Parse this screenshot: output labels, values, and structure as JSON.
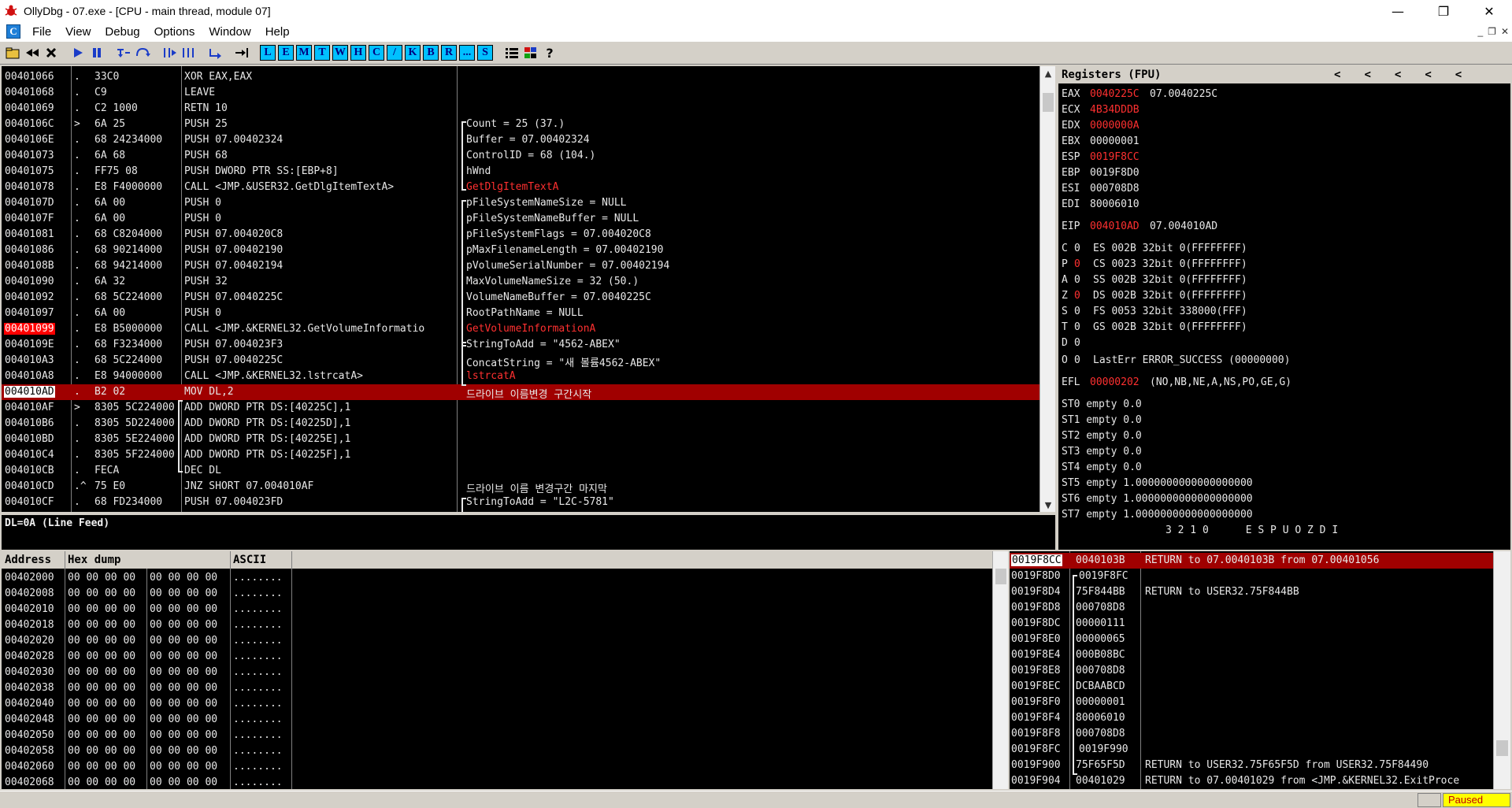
{
  "window": {
    "title": "OllyDbg - 07.exe - [CPU - main thread, module 07]",
    "minimize": "—",
    "maximize": "❐",
    "close": "✕"
  },
  "menu": {
    "items": [
      "File",
      "View",
      "Debug",
      "Options",
      "Window",
      "Help"
    ],
    "logo": "C"
  },
  "toolbar": {
    "letters": [
      "L",
      "E",
      "M",
      "T",
      "W",
      "H",
      "C",
      "/",
      "K",
      "B",
      "R",
      "...",
      "S"
    ]
  },
  "cpu": {
    "rows": [
      {
        "addr": "00401066",
        "mark": ".",
        "hex": "33C0",
        "asm": "XOR EAX,EAX",
        "cmt": ""
      },
      {
        "addr": "00401068",
        "mark": ".",
        "hex": "C9",
        "asm": "LEAVE",
        "cmt": ""
      },
      {
        "addr": "00401069",
        "mark": ".",
        "hex": "C2 1000",
        "asm": "RETN 10",
        "cmt": ""
      },
      {
        "addr": "0040106C",
        "mark": ">",
        "hex": "6A 25",
        "asm": "PUSH 25",
        "cmt": "Count = 25 (37.)"
      },
      {
        "addr": "0040106E",
        "mark": ".",
        "hex": "68 24234000",
        "asm": "PUSH 07.00402324",
        "cmt": "Buffer = 07.00402324"
      },
      {
        "addr": "00401073",
        "mark": ".",
        "hex": "6A 68",
        "asm": "PUSH 68",
        "cmt": "ControlID = 68 (104.)"
      },
      {
        "addr": "00401075",
        "mark": ".",
        "hex": "FF75 08",
        "asm": "PUSH DWORD PTR SS:[EBP+8]",
        "cmt": "hWnd"
      },
      {
        "addr": "00401078",
        "mark": ".",
        "hex": "E8 F4000000",
        "asm": "CALL <JMP.&USER32.GetDlgItemTextA>",
        "cmt": "GetDlgItemTextA"
      },
      {
        "addr": "0040107D",
        "mark": ".",
        "hex": "6A 00",
        "asm": "PUSH 0",
        "cmt": "pFileSystemNameSize = NULL"
      },
      {
        "addr": "0040107F",
        "mark": ".",
        "hex": "6A 00",
        "asm": "PUSH 0",
        "cmt": "pFileSystemNameBuffer = NULL"
      },
      {
        "addr": "00401081",
        "mark": ".",
        "hex": "68 C8204000",
        "asm": "PUSH 07.004020C8",
        "cmt": "pFileSystemFlags = 07.004020C8"
      },
      {
        "addr": "00401086",
        "mark": ".",
        "hex": "68 90214000",
        "asm": "PUSH 07.00402190",
        "cmt": "pMaxFilenameLength = 07.00402190"
      },
      {
        "addr": "0040108B",
        "mark": ".",
        "hex": "68 94214000",
        "asm": "PUSH 07.00402194",
        "cmt": "pVolumeSerialNumber = 07.00402194"
      },
      {
        "addr": "00401090",
        "mark": ".",
        "hex": "6A 32",
        "asm": "PUSH 32",
        "cmt": "MaxVolumeNameSize = 32 (50.)"
      },
      {
        "addr": "00401092",
        "mark": ".",
        "hex": "68 5C224000",
        "asm": "PUSH 07.0040225C",
        "cmt": "VolumeNameBuffer = 07.0040225C"
      },
      {
        "addr": "00401097",
        "mark": ".",
        "hex": "6A 00",
        "asm": "PUSH 0",
        "cmt": "RootPathName = NULL"
      },
      {
        "addr": "00401099",
        "mark": ".",
        "hex": "E8 B5000000",
        "asm": "CALL <JMP.&KERNEL32.GetVolumeInformatio",
        "cmt": "GetVolumeInformationA"
      },
      {
        "addr": "0040109E",
        "mark": ".",
        "hex": "68 F3234000",
        "asm": "PUSH 07.004023F3",
        "cmt": "StringToAdd = \"4562-ABEX\""
      },
      {
        "addr": "004010A3",
        "mark": ".",
        "hex": "68 5C224000",
        "asm": "PUSH 07.0040225C",
        "cmt": "ConcatString = \"새 볼륨4562-ABEX\""
      },
      {
        "addr": "004010A8",
        "mark": ".",
        "hex": "E8 94000000",
        "asm": "CALL <JMP.&KERNEL32.lstrcatA>",
        "cmt": "lstrcatA"
      },
      {
        "addr": "004010AD",
        "mark": ".",
        "hex": "B2 02",
        "asm": "MOV DL,2",
        "cmt": "드라이브 이름변경 구간시작"
      },
      {
        "addr": "004010AF",
        "mark": ">",
        "hex": "8305 5C224000",
        "asm": "ADD DWORD PTR DS:[40225C],1",
        "cmt": ""
      },
      {
        "addr": "004010B6",
        "mark": ".",
        "hex": "8305 5D224000",
        "asm": "ADD DWORD PTR DS:[40225D],1",
        "cmt": ""
      },
      {
        "addr": "004010BD",
        "mark": ".",
        "hex": "8305 5E224000",
        "asm": "ADD DWORD PTR DS:[40225E],1",
        "cmt": ""
      },
      {
        "addr": "004010C4",
        "mark": ".",
        "hex": "8305 5F224000",
        "asm": "ADD DWORD PTR DS:[40225F],1",
        "cmt": ""
      },
      {
        "addr": "004010CB",
        "mark": ".",
        "hex": "FECA",
        "asm": "DEC DL",
        "cmt": ""
      },
      {
        "addr": "004010CD",
        "mark": ".^",
        "hex": "75 E0",
        "asm": "JNZ SHORT 07.004010AF",
        "cmt": "드라이브 이름 변경구간 마지막"
      },
      {
        "addr": "004010CF",
        "mark": ".",
        "hex": "68 FD234000",
        "asm": "PUSH 07.004023FD",
        "cmt": "StringToAdd = \"L2C-5781\""
      }
    ],
    "info": "DL=0A (Line Feed)"
  },
  "registers": {
    "title": "Registers (FPU)",
    "arrows": [
      "<",
      "<",
      "<",
      "<",
      "<"
    ],
    "gp": [
      {
        "name": "EAX",
        "val": "0040225C",
        "extra": "07.0040225C",
        "red": true
      },
      {
        "name": "ECX",
        "val": "4B34DDDB",
        "extra": "",
        "red": true
      },
      {
        "name": "EDX",
        "val": "0000000A",
        "extra": "",
        "red": true
      },
      {
        "name": "EBX",
        "val": "00000001",
        "extra": "",
        "red": false
      },
      {
        "name": "ESP",
        "val": "0019F8CC",
        "extra": "",
        "red": true
      },
      {
        "name": "EBP",
        "val": "0019F8D0",
        "extra": "",
        "red": false
      },
      {
        "name": "ESI",
        "val": "000708D8",
        "extra": "",
        "red": false
      },
      {
        "name": "EDI",
        "val": "80006010",
        "extra": "",
        "red": false
      }
    ],
    "eip": {
      "name": "EIP",
      "val": "004010AD",
      "extra": "07.004010AD"
    },
    "flags": [
      {
        "f": "C",
        "v": "0",
        "red": false,
        "seg": "ES 002B 32bit 0(FFFFFFFF)"
      },
      {
        "f": "P",
        "v": "0",
        "red": true,
        "seg": "CS 0023 32bit 0(FFFFFFFF)"
      },
      {
        "f": "A",
        "v": "0",
        "red": false,
        "seg": "SS 002B 32bit 0(FFFFFFFF)"
      },
      {
        "f": "Z",
        "v": "0",
        "red": true,
        "seg": "DS 002B 32bit 0(FFFFFFFF)"
      },
      {
        "f": "S",
        "v": "0",
        "red": false,
        "seg": "FS 0053 32bit 338000(FFF)"
      },
      {
        "f": "T",
        "v": "0",
        "red": false,
        "seg": "GS 002B 32bit 0(FFFFFFFF)"
      },
      {
        "f": "D",
        "v": "0",
        "red": false,
        "seg": ""
      },
      {
        "f": "O",
        "v": "0",
        "red": false,
        "seg": "LastErr ERROR_SUCCESS (00000000)"
      }
    ],
    "efl": {
      "name": "EFL",
      "val": "00000202",
      "extra": "(NO,NB,NE,A,NS,PO,GE,G)"
    },
    "fpu": [
      "ST0 empty 0.0",
      "ST1 empty 0.0",
      "ST2 empty 0.0",
      "ST3 empty 0.0",
      "ST4 empty 0.0",
      "ST5 empty 1.0000000000000000000",
      "ST6 empty 1.0000000000000000000",
      "ST7 empty 1.0000000000000000000"
    ],
    "fpu_bits": "3 2 1 0      E S P U O Z D I"
  },
  "dump": {
    "headers": [
      "Address",
      "Hex dump",
      "ASCII"
    ],
    "rows": [
      {
        "addr": "00402000",
        "hex1": "00 00 00 00",
        "hex2": "00 00 00 00",
        "ascii": "........"
      },
      {
        "addr": "00402008",
        "hex1": "00 00 00 00",
        "hex2": "00 00 00 00",
        "ascii": "........"
      },
      {
        "addr": "00402010",
        "hex1": "00 00 00 00",
        "hex2": "00 00 00 00",
        "ascii": "........"
      },
      {
        "addr": "00402018",
        "hex1": "00 00 00 00",
        "hex2": "00 00 00 00",
        "ascii": "........"
      },
      {
        "addr": "00402020",
        "hex1": "00 00 00 00",
        "hex2": "00 00 00 00",
        "ascii": "........"
      },
      {
        "addr": "00402028",
        "hex1": "00 00 00 00",
        "hex2": "00 00 00 00",
        "ascii": "........"
      },
      {
        "addr": "00402030",
        "hex1": "00 00 00 00",
        "hex2": "00 00 00 00",
        "ascii": "........"
      },
      {
        "addr": "00402038",
        "hex1": "00 00 00 00",
        "hex2": "00 00 00 00",
        "ascii": "........"
      },
      {
        "addr": "00402040",
        "hex1": "00 00 00 00",
        "hex2": "00 00 00 00",
        "ascii": "........"
      },
      {
        "addr": "00402048",
        "hex1": "00 00 00 00",
        "hex2": "00 00 00 00",
        "ascii": "........"
      },
      {
        "addr": "00402050",
        "hex1": "00 00 00 00",
        "hex2": "00 00 00 00",
        "ascii": "........"
      },
      {
        "addr": "00402058",
        "hex1": "00 00 00 00",
        "hex2": "00 00 00 00",
        "ascii": "........"
      },
      {
        "addr": "00402060",
        "hex1": "00 00 00 00",
        "hex2": "00 00 00 00",
        "ascii": "........"
      },
      {
        "addr": "00402068",
        "hex1": "00 00 00 00",
        "hex2": "00 00 00 00",
        "ascii": "........"
      }
    ]
  },
  "stack": {
    "rows": [
      {
        "addr": "0019F8CC",
        "val": "0040103B",
        "cmt": "RETURN to 07.0040103B from 07.00401056"
      },
      {
        "addr": "0019F8D0",
        "val": "0019F8FC",
        "cmt": ""
      },
      {
        "addr": "0019F8D4",
        "val": "75F844BB",
        "cmt": "RETURN to USER32.75F844BB"
      },
      {
        "addr": "0019F8D8",
        "val": "000708D8",
        "cmt": ""
      },
      {
        "addr": "0019F8DC",
        "val": "00000111",
        "cmt": ""
      },
      {
        "addr": "0019F8E0",
        "val": "00000065",
        "cmt": ""
      },
      {
        "addr": "0019F8E4",
        "val": "000B08BC",
        "cmt": ""
      },
      {
        "addr": "0019F8E8",
        "val": "000708D8",
        "cmt": ""
      },
      {
        "addr": "0019F8EC",
        "val": "DCBAABCD",
        "cmt": ""
      },
      {
        "addr": "0019F8F0",
        "val": "00000001",
        "cmt": ""
      },
      {
        "addr": "0019F8F4",
        "val": "80006010",
        "cmt": ""
      },
      {
        "addr": "0019F8F8",
        "val": "000708D8",
        "cmt": ""
      },
      {
        "addr": "0019F8FC",
        "val": "0019F990",
        "cmt": ""
      },
      {
        "addr": "0019F900",
        "val": "75F65F5D",
        "cmt": "RETURN to USER32.75F65F5D from USER32.75F84490"
      },
      {
        "addr": "0019F904",
        "val": "00401029",
        "cmt": "RETURN to 07.00401029 from <JMP.&KERNEL32.ExitProce"
      }
    ]
  },
  "status": {
    "state": "Paused"
  }
}
